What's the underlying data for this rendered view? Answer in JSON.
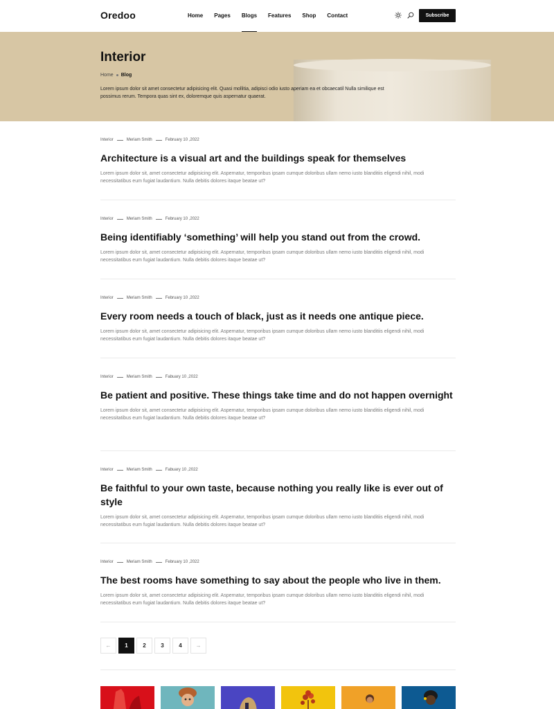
{
  "header": {
    "logo": "Oredoo",
    "nav": [
      "Home",
      "Pages",
      "Blogs",
      "Features",
      "Shop",
      "Contact"
    ],
    "active_nav": "Blogs",
    "subscribe_label": "Subscribe"
  },
  "hero": {
    "title": "Interior",
    "breadcrumb": {
      "home": "Home",
      "current": "Blog"
    },
    "description": "Lorem ipsum dolor sit amet consectetur adipisicing elit. Quasi mollitia, adipisci odio iusto aperiam ea et obcaecatil Nulla similique est possimus rerum. Tempora quas sint ex, doloremque quis aspernatur quaerat.",
    "background_color": "#d7c6a4"
  },
  "posts": [
    {
      "category": "Interior",
      "author": "Meriam Smith",
      "date": "February 10 ,2022",
      "title": "Architecture is a visual art and the buildings speak for themselves",
      "excerpt": "Lorem ipsum dolor sit, amet consectetur adipisicing elit. Aspernatur, temporibus ipsam cumque doloribus ullam nemo iusto blanditiis eligendi nihil, modi necessitatibus eum fugiat laudantium. Nulla debitis dolores itaque beatae ut?"
    },
    {
      "category": "Interior",
      "author": "Meriam Smith",
      "date": "February 10 ,2022",
      "title": "Being identifiably ‘something’ will help you stand out from the crowd.",
      "excerpt": "Lorem ipsum dolor sit, amet consectetur adipisicing elit. Aspernatur, temporibus ipsam cumque doloribus ullam nemo iusto blanditiis eligendi nihil, modi necessitatibus eum fugiat laudantium. Nulla debitis dolores itaque beatae ut?"
    },
    {
      "category": "Interior",
      "author": "Meriam Smith",
      "date": "February 10 ,2022",
      "title": "Every room needs a touch of black, just as it needs one antique piece.",
      "excerpt": "Lorem ipsum dolor sit, amet consectetur adipisicing elit. Aspernatur, temporibus ipsam cumque doloribus ullam nemo iusto blanditiis eligendi nihil, modi necessitatibus eum fugiat laudantium. Nulla debitis dolores itaque beatae ut?"
    },
    {
      "category": "Interior",
      "author": "Meriam Smith",
      "date": "Fabuary 10 ,2022",
      "title": "Be patient and positive. These things take time and do not happen overnight",
      "excerpt": "Lorem ipsum dolor sit, amet consectetur adipisicing elit. Aspernatur, temporibus ipsam cumque doloribus ullam nemo iusto blanditiis eligendi nihil, modi necessitatibus eum fugiat laudantium. Nulla debitis dolores itaque beatae ut?"
    },
    {
      "category": "Interior",
      "author": "Meriam Smith",
      "date": "Fabuary 10 ,2022",
      "title": "Be faithful to your own taste, because nothing you really like is ever out of style",
      "excerpt": "Lorem ipsum dolor sit, amet consectetur adipisicing elit. Aspernatur, temporibus ipsam cumque doloribus ullam nemo iusto blanditiis eligendi nihil, modi necessitatibus eum fugiat laudantium. Nulla debitis dolores itaque beatae ut?"
    },
    {
      "category": "Interior",
      "author": "Meriam Smith",
      "date": "February 10 ,2022",
      "title": "The best rooms have something to say about the people who live in them.",
      "excerpt": "Lorem ipsum dolor sit, amet consectetur adipisicing elit. Aspernatur, temporibus ipsam cumque doloribus ullam nemo iusto blanditiis eligendi nihil, modi necessitatibus eum fugiat laudantium. Nulla debitis dolores itaque beatae ut?"
    }
  ],
  "pagination": {
    "prev": "←",
    "pages": [
      "1",
      "2",
      "3",
      "4"
    ],
    "current": "1",
    "next": "→"
  },
  "thumbnails": [
    {
      "name": "red-portrait",
      "color": "#d8101a"
    },
    {
      "name": "child-cap-portrait",
      "color": "#6fb6bd"
    },
    {
      "name": "purple-portrait",
      "color": "#4a45c2"
    },
    {
      "name": "yellow-flower",
      "color": "#f2c40d"
    },
    {
      "name": "orange-portrait",
      "color": "#f0a128"
    },
    {
      "name": "blue-portrait",
      "color": "#0d5a92"
    }
  ]
}
